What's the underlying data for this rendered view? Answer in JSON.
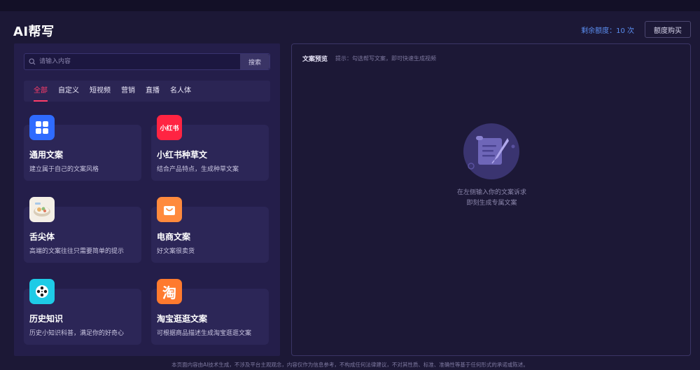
{
  "header": {
    "title": "AI帮写",
    "quota_label": "剩余额度",
    "quota_value": "10 次",
    "buy_label": "额度购买"
  },
  "search": {
    "placeholder": "请输入内容",
    "button_label": "搜索"
  },
  "tabs": [
    {
      "label": "全部",
      "active": true
    },
    {
      "label": "自定义"
    },
    {
      "label": "短视频"
    },
    {
      "label": "营销"
    },
    {
      "label": "直播"
    },
    {
      "label": "名人体"
    }
  ],
  "cards": [
    {
      "title": "通用文案",
      "desc": "建立属于自己的文案风格",
      "icon": "grid-icon",
      "color": "#2f6bff"
    },
    {
      "title": "小红书种草文",
      "desc": "结合产品特点，生成种草文案",
      "icon": "xiaohongshu-icon",
      "color": "#ff2442",
      "icon_text": "小红书"
    },
    {
      "title": "舌尖体",
      "desc": "高端的文案往往只需要简单的提示",
      "icon": "food-icon",
      "color": "#f4efe6"
    },
    {
      "title": "电商文案",
      "desc": "好文案很卖货",
      "icon": "shopping-bag-icon",
      "color": "#ff8a3d"
    },
    {
      "title": "历史知识",
      "desc": "历史小知识科普，满足你的好奇心",
      "icon": "film-reel-icon",
      "color": "#1ecbe6"
    },
    {
      "title": "淘宝逛逛文案",
      "desc": "可根据商品描述生成淘宝逛逛文案",
      "icon": "taobao-icon",
      "color": "#ff7a2e",
      "icon_text": "淘"
    }
  ],
  "preview": {
    "label": "文案预览",
    "hint": "提示：勾选帮写文案，即可快速生成视频",
    "empty_line1": "在左侧输入你的文案诉求",
    "empty_line2": "即刻生成专属文案"
  },
  "footer": "本页面内容由AI技术生成，不涉及平台主观观念，内容仅作为信息参考，不构成任何法律建议，不对其性质、标准、准确性等基于任何形式的承诺或陈述。"
}
